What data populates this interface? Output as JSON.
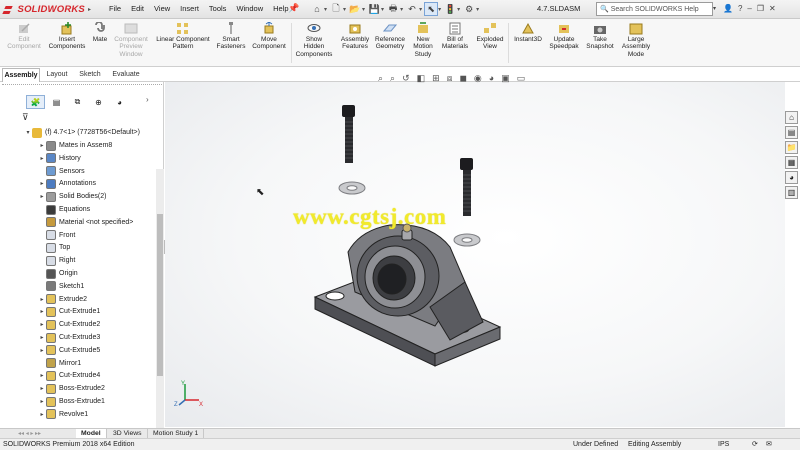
{
  "app": {
    "brand": "SOLIDWORKS",
    "document_title": "4.7.SLDASM"
  },
  "menu": [
    "File",
    "Edit",
    "View",
    "Insert",
    "Tools",
    "Window",
    "Help"
  ],
  "search": {
    "placeholder": "Search SOLIDWORKS Help"
  },
  "ribbon": {
    "buttons": [
      {
        "id": "edit-component",
        "label": "Edit\nComponent",
        "enabled": false
      },
      {
        "id": "insert-components",
        "label": "Insert\nComponents",
        "enabled": true
      },
      {
        "id": "mate",
        "label": "Mate",
        "enabled": true
      },
      {
        "id": "component-preview-window",
        "label": "Component\nPreview\nWindow",
        "enabled": false
      },
      {
        "id": "linear-component-pattern",
        "label": "Linear Component\nPattern",
        "enabled": true
      },
      {
        "id": "smart-fasteners",
        "label": "Smart\nFasteners",
        "enabled": true
      },
      {
        "id": "move-component",
        "label": "Move\nComponent",
        "enabled": true
      },
      {
        "id": "show-hidden-components",
        "label": "Show\nHidden\nComponents",
        "enabled": true
      },
      {
        "id": "assembly-features",
        "label": "Assembly\nFeatures",
        "enabled": true
      },
      {
        "id": "reference-geometry",
        "label": "Reference\nGeometry",
        "enabled": true
      },
      {
        "id": "new-motion-study",
        "label": "New\nMotion\nStudy",
        "enabled": true
      },
      {
        "id": "bill-of-materials",
        "label": "Bill of\nMaterials",
        "enabled": true
      },
      {
        "id": "exploded-view",
        "label": "Exploded\nView",
        "enabled": true
      },
      {
        "id": "instant3d",
        "label": "Instant3D",
        "enabled": true
      },
      {
        "id": "update-speedpak",
        "label": "Update\nSpeedpak",
        "enabled": true
      },
      {
        "id": "take-snapshot",
        "label": "Take\nSnapshot",
        "enabled": true
      },
      {
        "id": "large-assembly-mode",
        "label": "Large\nAssembly\nMode",
        "enabled": true
      }
    ]
  },
  "command_tabs": [
    "Assembly",
    "Layout",
    "Sketch",
    "Evaluate"
  ],
  "active_command_tab": "Assembly",
  "feature_tree": {
    "root": "(f) 4.7<1> (7728T56<Default>)",
    "items": [
      {
        "label": "Mates in Assem8",
        "icon": "mates-icon",
        "expandable": true
      },
      {
        "label": "History",
        "icon": "history-icon",
        "expandable": true
      },
      {
        "label": "Sensors",
        "icon": "sensors-icon",
        "expandable": false
      },
      {
        "label": "Annotations",
        "icon": "annotations-icon",
        "expandable": true
      },
      {
        "label": "Solid Bodies(2)",
        "icon": "solid-bodies-icon",
        "expandable": true
      },
      {
        "label": "Equations",
        "icon": "equations-icon",
        "expandable": false
      },
      {
        "label": "Material <not specified>",
        "icon": "material-icon",
        "expandable": false
      },
      {
        "label": "Front",
        "icon": "plane-icon",
        "expandable": false
      },
      {
        "label": "Top",
        "icon": "plane-icon",
        "expandable": false
      },
      {
        "label": "Right",
        "icon": "plane-icon",
        "expandable": false
      },
      {
        "label": "Origin",
        "icon": "origin-icon",
        "expandable": false
      },
      {
        "label": "Sketch1",
        "icon": "sketch-icon",
        "expandable": false
      },
      {
        "label": "Extrude2",
        "icon": "extrude-icon",
        "expandable": true
      },
      {
        "label": "Cut-Extrude1",
        "icon": "cut-extrude-icon",
        "expandable": true
      },
      {
        "label": "Cut-Extrude2",
        "icon": "cut-extrude-icon",
        "expandable": true
      },
      {
        "label": "Cut-Extrude3",
        "icon": "cut-extrude-icon",
        "expandable": true
      },
      {
        "label": "Cut-Extrude5",
        "icon": "cut-extrude-icon",
        "expandable": true
      },
      {
        "label": "Mirror1",
        "icon": "mirror-icon",
        "expandable": false
      },
      {
        "label": "Cut-Extrude4",
        "icon": "cut-extrude-icon",
        "expandable": true
      },
      {
        "label": "Boss-Extrude2",
        "icon": "boss-extrude-icon",
        "expandable": true
      },
      {
        "label": "Boss-Extrude1",
        "icon": "boss-extrude-icon",
        "expandable": true
      },
      {
        "label": "Revolve1",
        "icon": "revolve-icon",
        "expandable": true
      }
    ]
  },
  "watermark": "www.cgtsj.com",
  "bottom_tabs": [
    "Model",
    "3D Views",
    "Motion Study 1"
  ],
  "active_bottom_tab": "Model",
  "status": {
    "edition": "SOLIDWORKS Premium 2018 x64 Edition",
    "state": "Under Defined",
    "editing": "Editing Assembly",
    "units": "IPS"
  },
  "colors": {
    "brand": "#d6262c",
    "watermark": "#f1ea2c",
    "model_gray": "#6d6e72"
  }
}
